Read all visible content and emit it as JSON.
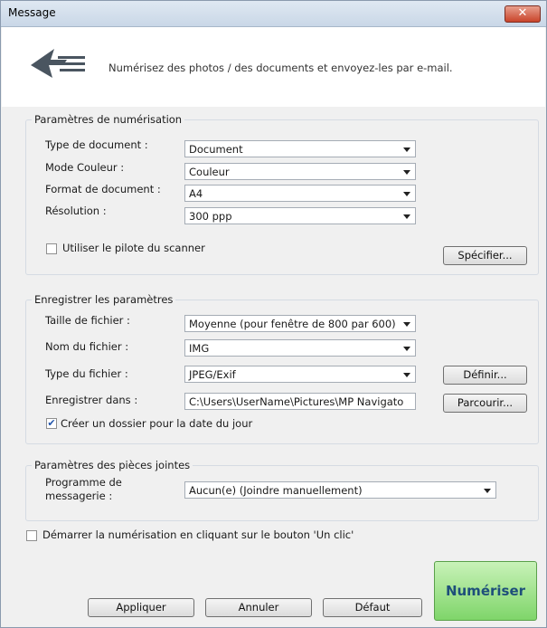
{
  "window": {
    "title": "Message",
    "close_label": "✕"
  },
  "header": {
    "description": "Numérisez des photos / des documents et envoyez-les par e-mail."
  },
  "scan_settings": {
    "title": "Paramètres de numérisation",
    "document_type": {
      "label": "Type de document :",
      "value": "Document"
    },
    "color_mode": {
      "label": "Mode Couleur :",
      "value": "Couleur"
    },
    "document_size": {
      "label": "Format de document :",
      "value": "A4"
    },
    "resolution": {
      "label": "Résolution :",
      "value": "300 ppp"
    },
    "use_driver": {
      "label": "Utiliser le pilote du scanner",
      "checked": false
    },
    "specify_button": "Spécifier..."
  },
  "save_settings": {
    "title": "Enregistrer les paramètres",
    "file_size": {
      "label": "Taille de fichier :",
      "value": "Moyenne (pour fenêtre de 800 par 600)"
    },
    "file_name": {
      "label": "Nom du fichier :",
      "value": "IMG"
    },
    "file_type": {
      "label": "Type du fichier :",
      "value": "JPEG/Exif"
    },
    "define_button": "Définir...",
    "save_in": {
      "label": "Enregistrer dans :",
      "value": "C:\\Users\\UserName\\Pictures\\MP Navigato"
    },
    "browse_button": "Parcourir...",
    "create_folder": {
      "label": "Créer un dossier pour la date du jour",
      "checked": true
    }
  },
  "attachment_settings": {
    "title": "Paramètres des pièces jointes",
    "mail_program": {
      "label_line1": "Programme de",
      "label_line2": "messagerie :",
      "value": "Aucun(e) (Joindre manuellement)"
    }
  },
  "one_click": {
    "label": "Démarrer la numérisation en cliquant sur le bouton 'Un clic'",
    "checked": false
  },
  "buttons": {
    "apply": "Appliquer",
    "cancel": "Annuler",
    "default": "Défaut",
    "scan": "Numériser"
  }
}
